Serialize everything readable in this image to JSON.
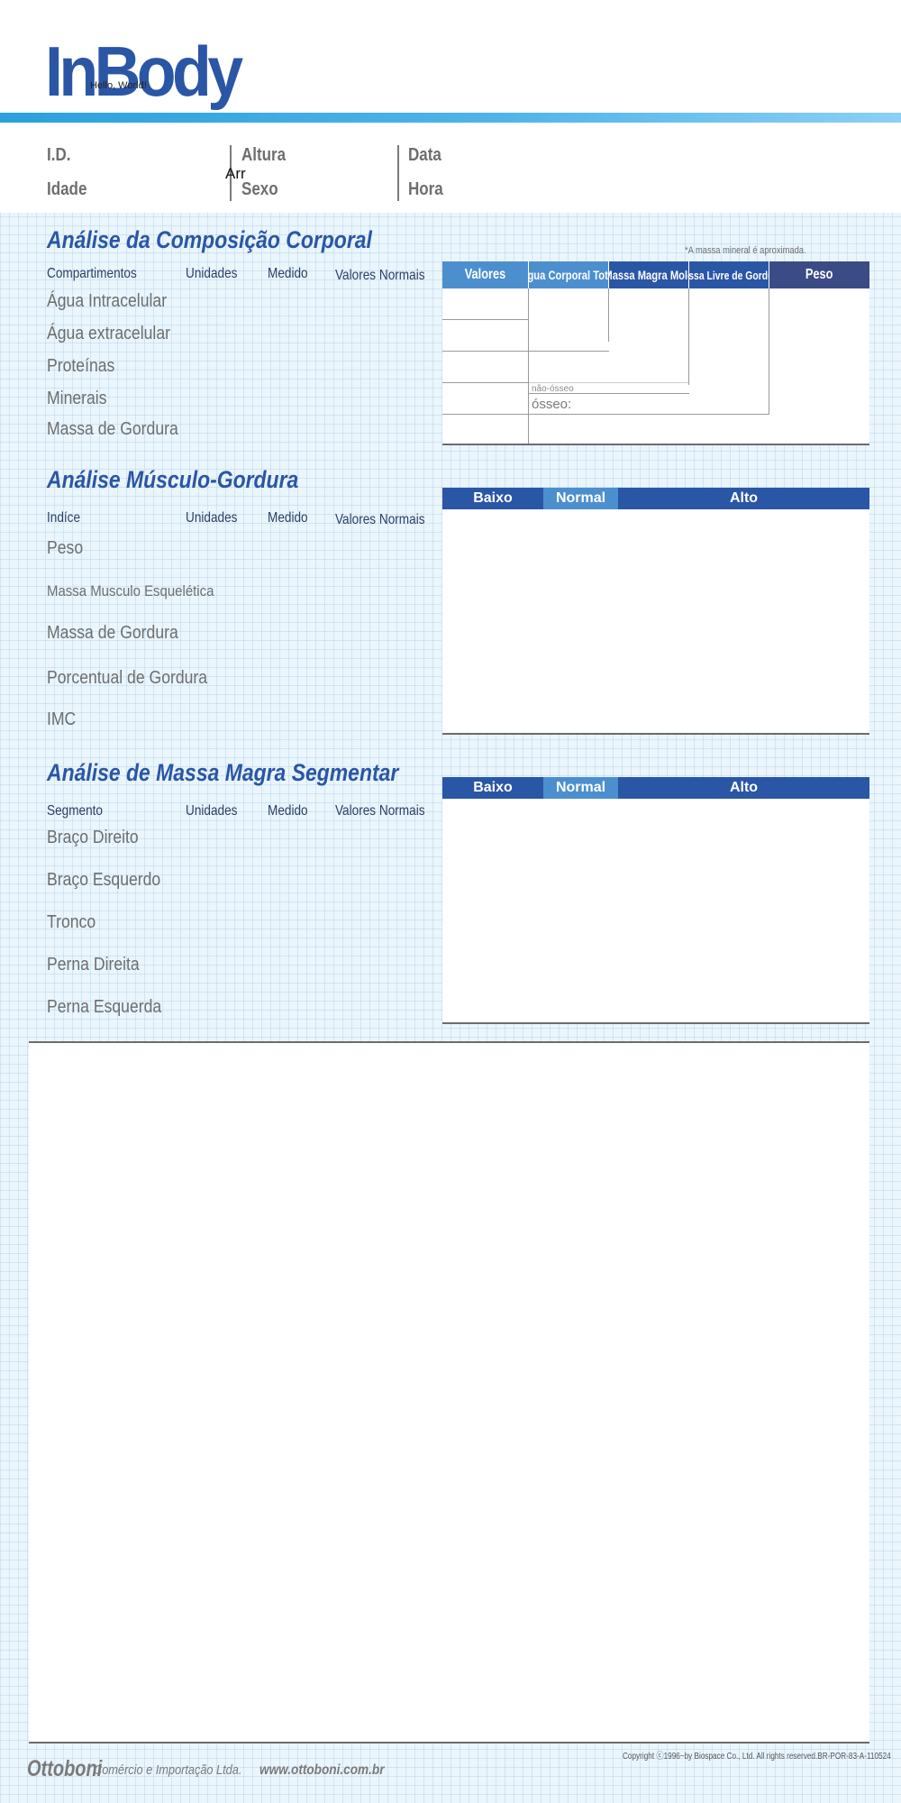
{
  "header": {
    "logo": "InBody",
    "overlay_text": "Hello, World!"
  },
  "patient_info": {
    "id_label": "I.D.",
    "age_label": "Idade",
    "height_label": "Altura",
    "sex_label": "Sexo",
    "date_label": "Data",
    "time_label": "Hora",
    "overlay_text": "Arr"
  },
  "body_composition": {
    "title": "Análise da Composição Corporal",
    "mineral_note": "*A massa mineral é aproximada.",
    "columns": [
      "Compartimentos",
      "Unidades",
      "Medido",
      "Valores Normais"
    ],
    "rows": [
      "Água Intracelular",
      "Água extracelular",
      "Proteínas",
      "Minerais",
      "Massa de Gordura"
    ],
    "table_headers": [
      "Valores",
      "Água Corporal Total",
      "Massa Magra Mole",
      "Massa Livre de Gordura",
      "Peso"
    ],
    "non_bone_label": "não-ósseo",
    "bone_label": "ósseo:",
    "colors": {
      "light_header": "#4c8fcf",
      "dark_header": "#3a4b86"
    }
  },
  "muscle_fat": {
    "title": "Análise Músculo-Gordura",
    "columns": [
      "Indíce",
      "Unidades",
      "Medido",
      "Valores Normais"
    ],
    "rows": [
      "Peso",
      "Massa Musculo Esquelética",
      "Massa de Gordura",
      "Porcentual de Gordura",
      "IMC"
    ],
    "scale": {
      "low": "Baixo",
      "normal": "Normal",
      "high": "Alto"
    }
  },
  "segmental": {
    "title": "Análise de Massa Magra Segmentar",
    "columns": [
      "Segmento",
      "Unidades",
      "Medido",
      "Valores Normais"
    ],
    "rows": [
      "Braço Direito",
      "Braço Esquerdo",
      "Tronco",
      "Perna Direita",
      "Perna Esquerda"
    ],
    "scale": {
      "low": "Baixo",
      "normal": "Normal",
      "high": "Alto"
    }
  },
  "footer": {
    "copyright": "Copyright ⓒ1996~by Biospace Co., Ltd. All rights reserved.BR-POR-83-A-110524",
    "company_name": "Ottoboni",
    "company_sub": "Comércio e Importação Ltda.",
    "company_url": "www.ottoboni.com.br"
  },
  "colors": {
    "brand_blue": "#2a56a6",
    "scale_low": "#2a56a6",
    "scale_normal": "#4c8fcf",
    "scale_high": "#2a56a6"
  }
}
